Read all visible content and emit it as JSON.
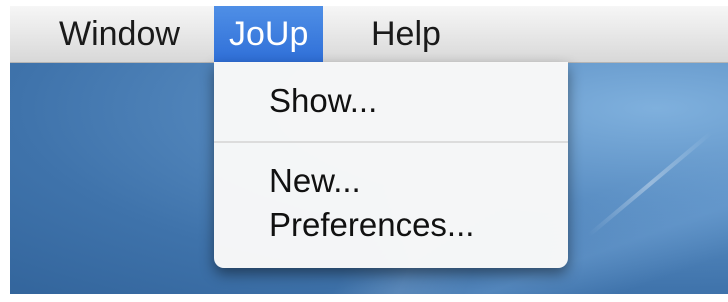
{
  "menubar": {
    "items": [
      {
        "label": "Window",
        "active": false
      },
      {
        "label": "JoUp",
        "active": true
      },
      {
        "label": "Help",
        "active": false
      }
    ]
  },
  "menu": {
    "items": [
      {
        "label": "Show..."
      },
      {
        "label": "New..."
      },
      {
        "label": "Preferences..."
      }
    ]
  },
  "colors": {
    "active_highlight": "#2f6fd8",
    "desktop": "#4a7fb8"
  }
}
